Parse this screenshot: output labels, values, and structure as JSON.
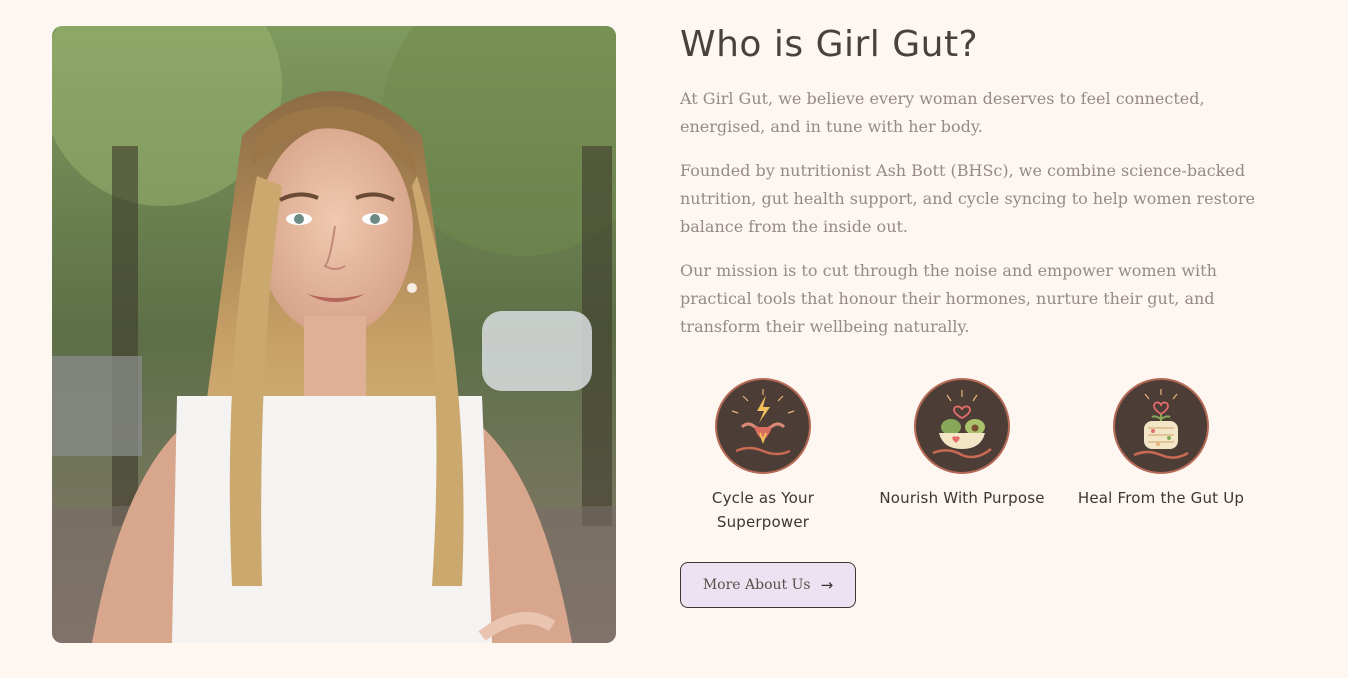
{
  "about": {
    "title": "Who is Girl Gut?",
    "paragraphs": [
      "At Girl Gut, we believe every woman deserves to feel connected, energised, and in tune with her body.",
      "Founded by nutritionist Ash Bott (BHSc), we combine science-backed nutrition, gut health support, and cycle syncing to help women restore balance from the inside out.",
      "Our mission is to cut through the noise and empower women with practical tools that honour their hormones, nurture their gut, and transform their wellbeing naturally."
    ],
    "features": [
      {
        "label": "Cycle as Your Superpower",
        "icon": "uterus-lightning-icon"
      },
      {
        "label": "Nourish With Purpose",
        "icon": "avocado-bowl-icon"
      },
      {
        "label": "Heal From the Gut Up",
        "icon": "gut-heart-icon"
      }
    ],
    "cta": {
      "label": "More About Us",
      "icon": "arrow-right-icon"
    }
  },
  "colors": {
    "background": "#fdf6f1",
    "heading": "#4a403d",
    "body_text": "#958a86",
    "badge_bg": "#4d3d37",
    "badge_ring": "#b46a55",
    "button_bg": "#ece2f1"
  }
}
